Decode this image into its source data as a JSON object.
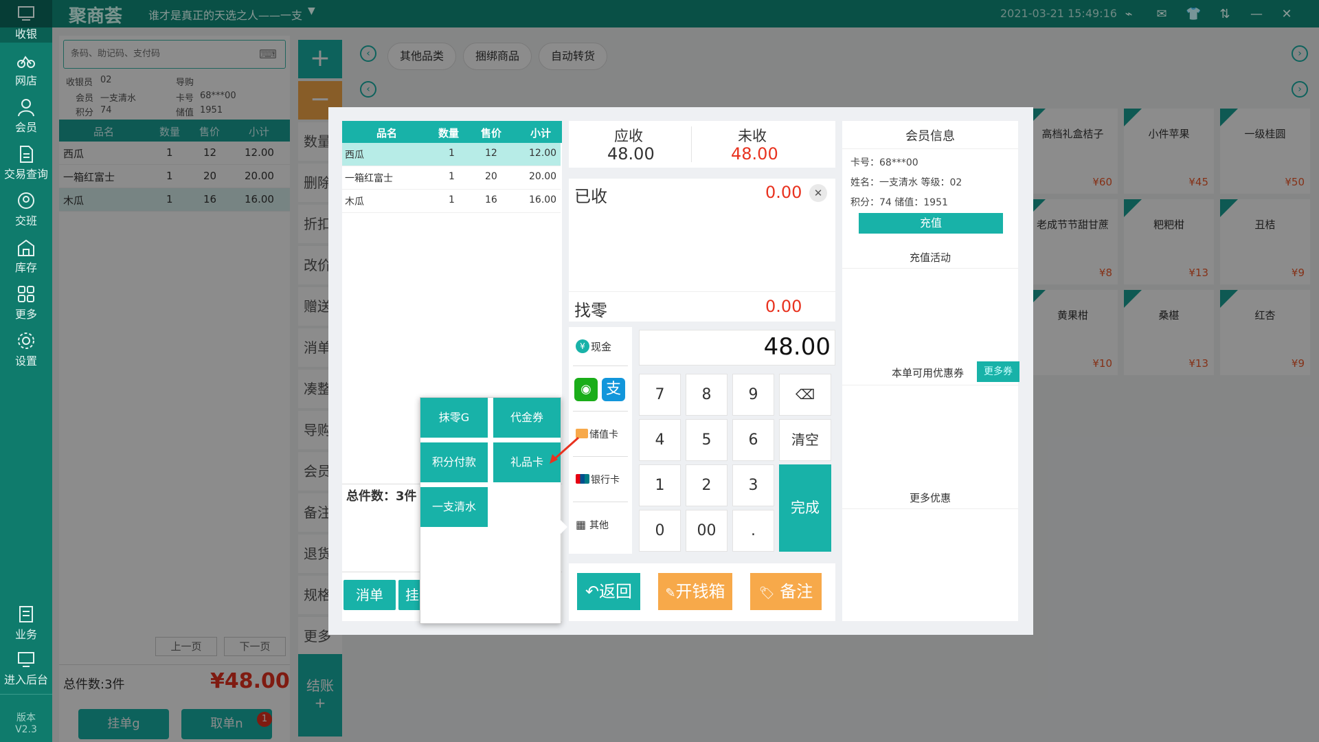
{
  "app": {
    "logo": "聚商荟",
    "slogan": "谁才是真正的天选之人——一支",
    "datetime": "2021-03-21 15:49:16"
  },
  "sidebar": {
    "items": [
      {
        "label": "收银",
        "icon": "cashier-icon"
      },
      {
        "label": "网店",
        "icon": "bike-icon"
      },
      {
        "label": "会员",
        "icon": "user-icon"
      },
      {
        "label": "交易查询",
        "icon": "document-icon"
      },
      {
        "label": "交班",
        "icon": "handover-icon"
      },
      {
        "label": "库存",
        "icon": "warehouse-icon"
      },
      {
        "label": "更多",
        "icon": "grid-icon"
      },
      {
        "label": "设置",
        "icon": "settings-icon"
      },
      {
        "label": "业务",
        "icon": "business-icon"
      },
      {
        "label": "进入后台",
        "icon": "monitor-icon"
      }
    ],
    "version_label": "版本",
    "version": "V2.3"
  },
  "left": {
    "search_placeholder": "条码、助记码、支付码",
    "cashier_label": "收银员",
    "cashier": "02",
    "guide_label": "导购",
    "member_label": "会员",
    "member": "一支清水",
    "card_label": "卡号",
    "card": "68***00",
    "points_label": "积分",
    "points": "74",
    "balance_label": "储值",
    "balance": "1951",
    "columns": [
      "品名",
      "数量",
      "售价",
      "小计"
    ],
    "rows": [
      {
        "name": "西瓜",
        "qty": "1",
        "price": "12",
        "sub": "12.00"
      },
      {
        "name": "一箱红富士",
        "qty": "1",
        "price": "20",
        "sub": "20.00"
      },
      {
        "name": "木瓜",
        "qty": "1",
        "price": "16",
        "sub": "16.00"
      }
    ],
    "prev": "上一页",
    "next": "下一页",
    "total_count": "总件数:3件",
    "total_amount": "¥48.00",
    "hold": "挂单g",
    "retrieve": "取单n",
    "retrieve_badge": "1"
  },
  "actions": [
    "数量",
    "删除",
    "折扣",
    "改价",
    "赠送",
    "消单",
    "凑整",
    "导购",
    "会员",
    "备注",
    "退货",
    "规格",
    "更多"
  ],
  "checkout": "结账",
  "categories": [
    "其他品类",
    "捆绑商品",
    "自动转货"
  ],
  "products": [
    {
      "name": "高档礼盒桔子",
      "price": "¥60"
    },
    {
      "name": "小件苹果",
      "price": "¥45"
    },
    {
      "name": "一级桂圆",
      "price": "¥50"
    },
    {
      "name": "老成节节甜甘蔗",
      "price": "¥8"
    },
    {
      "name": "粑粑柑",
      "price": "¥13"
    },
    {
      "name": "丑桔",
      "price": "¥9"
    },
    {
      "name": "黄果柑",
      "price": "¥10"
    },
    {
      "name": "桑椹",
      "price": "¥13"
    },
    {
      "name": "红杏",
      "price": "¥9"
    }
  ],
  "modal": {
    "columns": [
      "品名",
      "数量",
      "售价",
      "小计"
    ],
    "rows": [
      {
        "name": "西瓜",
        "qty": "1",
        "price": "12",
        "sub": "12.00"
      },
      {
        "name": "一箱红富士",
        "qty": "1",
        "price": "20",
        "sub": "20.00"
      },
      {
        "name": "木瓜",
        "qty": "1",
        "price": "16",
        "sub": "16.00"
      }
    ],
    "total_count": "总件数：3件",
    "cancel": "消单",
    "hang": "挂",
    "due_label": "应收",
    "due": "48.00",
    "unpaid_label": "未收",
    "unpaid": "48.00",
    "paid_label": "已收",
    "paid": "0.00",
    "change_label": "找零",
    "change": "0.00",
    "amount": "48.00",
    "pay": {
      "cash": "现金",
      "stored": "储值卡",
      "bank": "银行卡",
      "other": "其他"
    },
    "keys": [
      "7",
      "8",
      "9",
      "4",
      "5",
      "6",
      "1",
      "2",
      "3",
      "0",
      "00",
      "."
    ],
    "clear": "清空",
    "done": "完成",
    "back": "返回",
    "drawer": "开钱箱",
    "note": "备注",
    "member_title": "会员信息",
    "card_line": "卡号：68***00",
    "name_line": "姓名：一支清水  等级：02",
    "points_line": "积分：74  储值：1951",
    "recharge": "充值",
    "recharge_activity": "充值活动",
    "coupon_label": "本单可用优惠券",
    "more_coupon": "更多券",
    "more_discount": "更多优惠",
    "popup": [
      "抹零G",
      "代金券",
      "积分付款",
      "礼品卡",
      "一支清水"
    ]
  },
  "colors": {
    "primary": "#18b2a8",
    "sidebar": "#0f7b6c",
    "orange": "#f7a94a",
    "red": "#e8321f"
  }
}
